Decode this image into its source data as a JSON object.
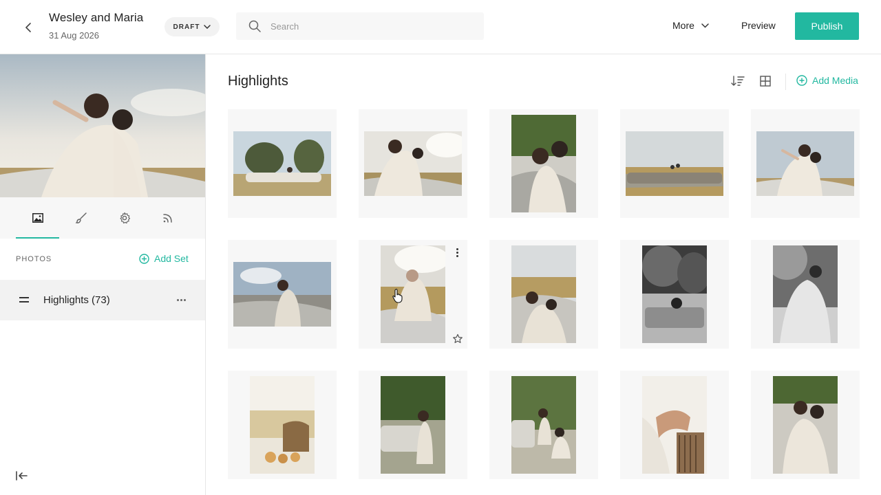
{
  "header": {
    "gallery_title": "Wesley and Maria",
    "gallery_date": "31 Aug 2026",
    "status": "DRAFT",
    "search_placeholder": "Search",
    "more_label": "More",
    "preview_label": "Preview",
    "publish_label": "Publish"
  },
  "sidebar": {
    "tabs": [
      "photos-tab",
      "design-tab",
      "settings-tab",
      "activity-tab"
    ],
    "active_tab": "photos-tab",
    "photos_label": "PHOTOS",
    "add_set_label": "Add Set",
    "sets": [
      {
        "name": "Highlights (73)"
      }
    ]
  },
  "main": {
    "section_title": "Highlights",
    "add_media_label": "Add Media"
  },
  "colors": {
    "accent": "#22b8a0",
    "panel": "#f7f7f7",
    "border": "#e6e6e6"
  }
}
